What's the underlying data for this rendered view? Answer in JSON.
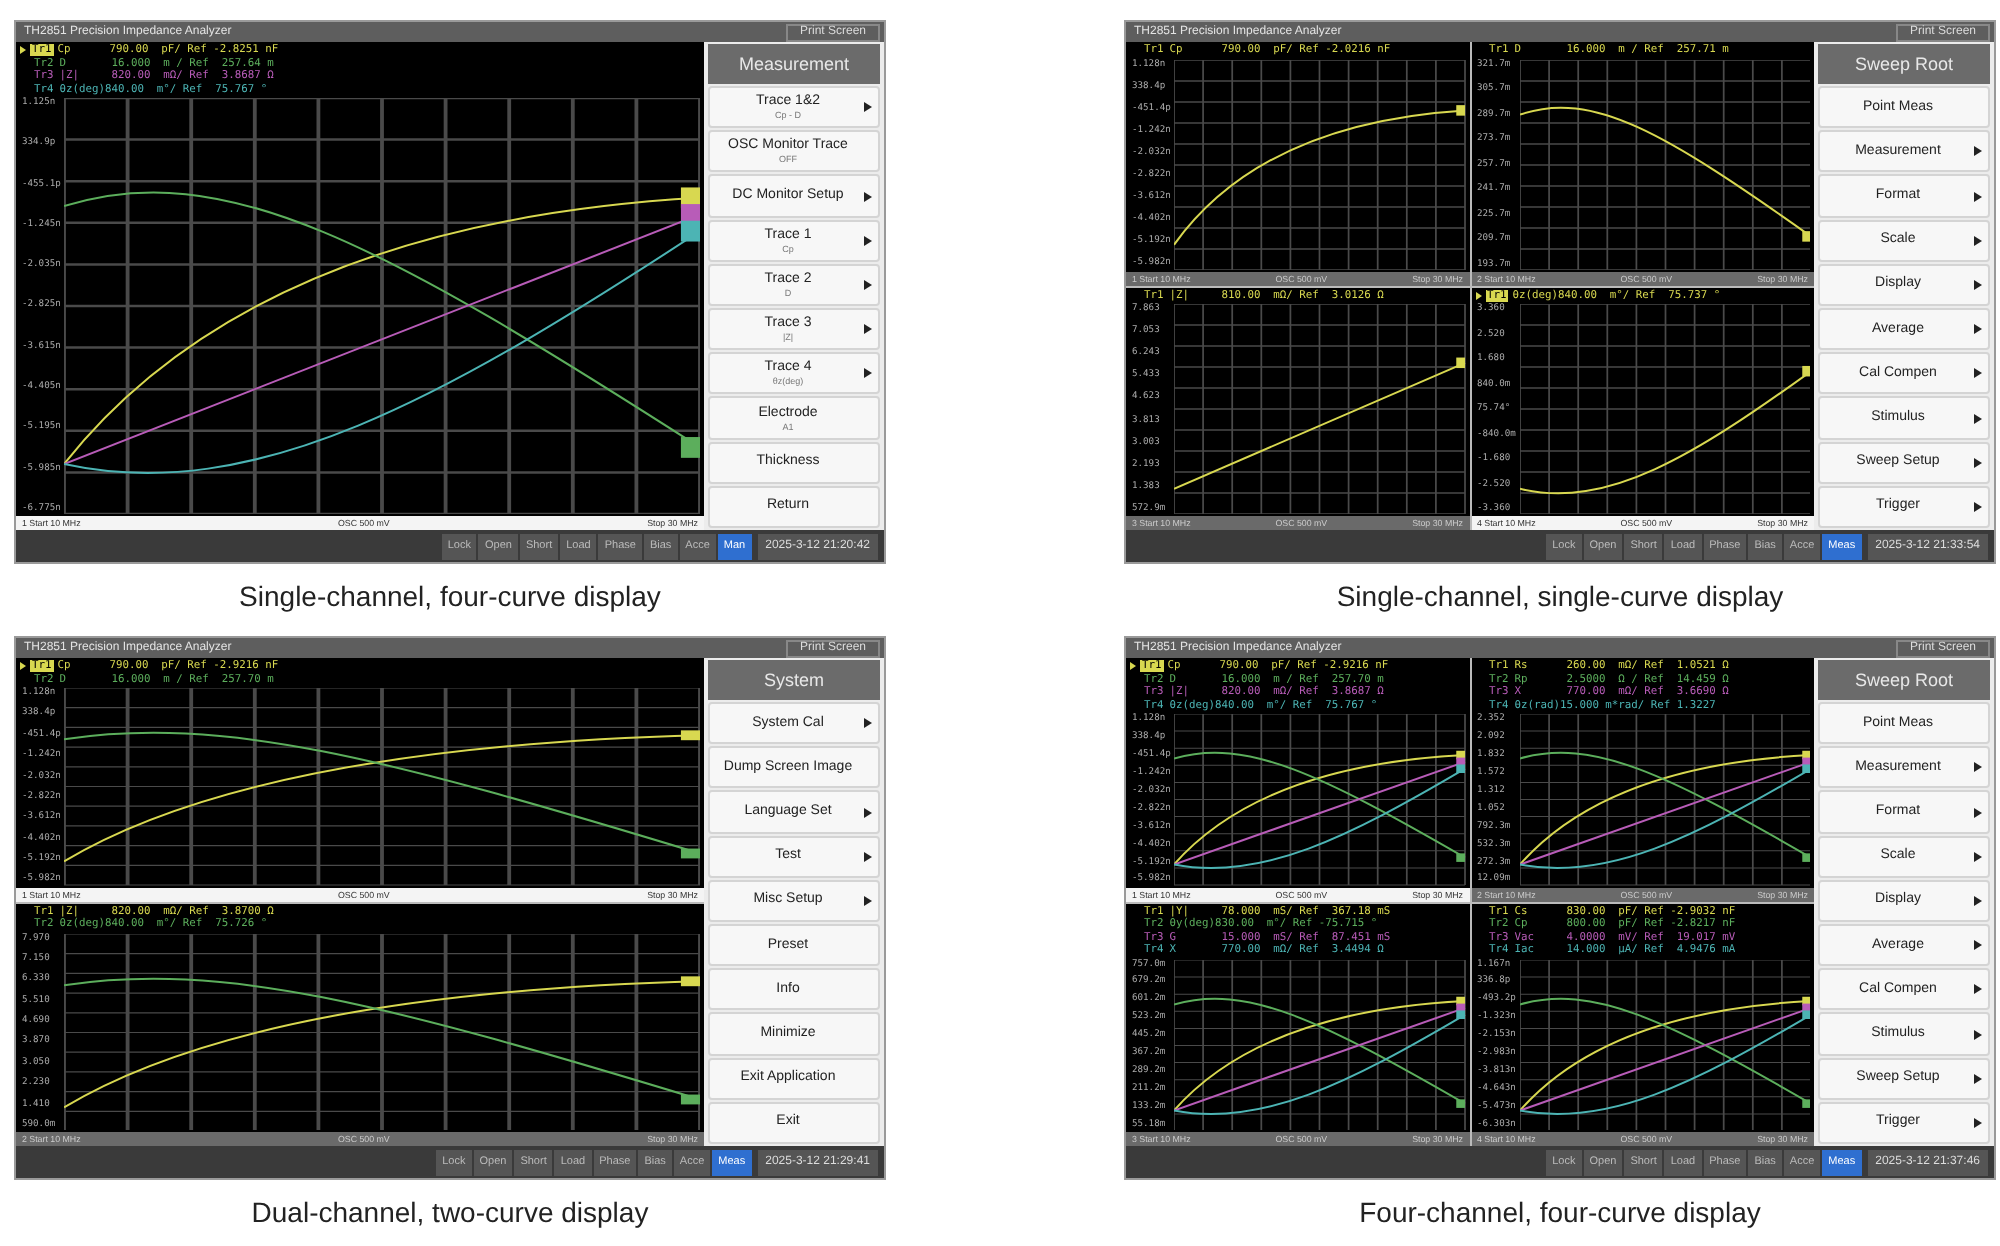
{
  "screens": [
    {
      "caption": "Single-channel, four-curve display",
      "window": {
        "title": "TH2851 Precision Impedance Analyzer",
        "print_button": "Print Screen"
      },
      "panes": [
        {
          "selected": true,
          "traces": [
            {
              "label": "Tr1",
              "text": "Cp      790.00  pF/ Ref -2.8251 nF",
              "color": "#d8d850",
              "selected": true
            },
            {
              "label": "Tr2",
              "text": "D       16.000  m / Ref  257.64 m",
              "color": "#5cae5c",
              "selected": false
            },
            {
              "label": "Tr3",
              "text": "|Z|     820.00  mΩ/ Ref  3.8687 Ω",
              "color": "#b85cb8",
              "selected": false
            },
            {
              "label": "Tr4",
              "text": "θz(deg)840.00  m°/ Ref  75.767 °",
              "color": "#4cb4b4",
              "selected": false
            }
          ],
          "y_ticks": [
            "1.125n",
            "334.9p",
            "-455.1p",
            "-1.245n",
            "-2.035n",
            "-2.825n",
            "-3.615n",
            "-4.405n",
            "-5.195n",
            "-5.985n",
            "-6.775n"
          ],
          "footer": {
            "channel": "1",
            "start": "Start 10 MHz",
            "osc": "OSC 500 mV",
            "stop": "Stop 30 MHz"
          }
        }
      ],
      "menu": {
        "title": "Measurement",
        "items": [
          {
            "label": "Trace 1&2",
            "value": "Cp - D",
            "submenu": true
          },
          {
            "label": "OSC Monitor Trace",
            "value": "OFF",
            "submenu": false
          },
          {
            "label": "DC Monitor Setup",
            "submenu": true
          },
          {
            "label": "Trace 1",
            "value": "Cp",
            "submenu": true
          },
          {
            "label": "Trace 2",
            "value": "D",
            "submenu": true
          },
          {
            "label": "Trace 3",
            "value": "|Z|",
            "submenu": true
          },
          {
            "label": "Trace 4",
            "value": "θz(deg)",
            "submenu": true
          },
          {
            "label": "Electrode",
            "value": "A1",
            "submenu": false
          },
          {
            "label": "Thickness",
            "submenu": false
          },
          {
            "label": "Return",
            "submenu": false
          }
        ]
      },
      "status": {
        "buttons": [
          {
            "label": "Lock",
            "selected": false
          },
          {
            "label": "Open",
            "selected": false
          },
          {
            "label": "Short",
            "selected": false
          },
          {
            "label": "Load",
            "selected": false
          },
          {
            "label": "Phase",
            "selected": false
          },
          {
            "label": "Bias",
            "selected": false
          },
          {
            "label": "Acce",
            "selected": false
          },
          {
            "label": "Man",
            "selected": true
          }
        ],
        "time": "2025-3-12 21:20:42"
      }
    },
    {
      "caption": "Single-channel, single-curve display",
      "window": {
        "title": "TH2851 Precision Impedance Analyzer",
        "print_button": "Print Screen"
      },
      "panes": [
        {
          "selected": false,
          "traces": [
            {
              "label": "Tr1",
              "text": "Cp      790.00  pF/ Ref -2.0216 nF",
              "color": "#d8d850",
              "selected": false
            }
          ],
          "y_ticks": [
            "1.128n",
            "338.4p",
            "-451.4p",
            "-1.242n",
            "-2.032n",
            "-2.822n",
            "-3.612n",
            "-4.402n",
            "-5.192n",
            "-5.982n"
          ],
          "footer": {
            "channel": "1",
            "start": "Start 10 MHz",
            "osc": "OSC 500 mV",
            "stop": "Stop 30 MHz"
          }
        },
        {
          "selected": false,
          "traces": [
            {
              "label": "Tr1",
              "text": "D       16.000  m / Ref  257.71 m",
              "color": "#d8d850",
              "selected": false
            }
          ],
          "y_ticks": [
            "321.7m",
            "305.7m",
            "289.7m",
            "273.7m",
            "257.7m",
            "241.7m",
            "225.7m",
            "209.7m",
            "193.7m"
          ],
          "footer": {
            "channel": "2",
            "start": "Start 10 MHz",
            "osc": "OSC 500 mV",
            "stop": "Stop 30 MHz"
          }
        },
        {
          "selected": false,
          "traces": [
            {
              "label": "Tr1",
              "text": "|Z|     810.00  mΩ/ Ref  3.0126 Ω",
              "color": "#d8d850",
              "selected": false
            }
          ],
          "y_ticks": [
            "7.863",
            "7.053",
            "6.243",
            "5.433",
            "4.623",
            "3.813",
            "3.003",
            "2.193",
            "1.383",
            "572.9m"
          ],
          "footer": {
            "channel": "3",
            "start": "Start 10 MHz",
            "osc": "OSC 500 mV",
            "stop": "Stop 30 MHz"
          }
        },
        {
          "selected": true,
          "traces": [
            {
              "label": "Tr1",
              "text": "θz(deg)840.00  m°/ Ref  75.737 °",
              "color": "#d8d850",
              "selected": true
            }
          ],
          "y_ticks": [
            "3.360",
            "2.520",
            "1.680",
            "840.0m",
            "75.74°",
            "-840.0m",
            "-1.680",
            "-2.520",
            "-3.360"
          ],
          "footer": {
            "channel": "4",
            "start": "Start 10 MHz",
            "osc": "OSC 500 mV",
            "stop": "Stop 30 MHz"
          }
        }
      ],
      "menu": {
        "title": "Sweep Root",
        "items": [
          {
            "label": "Point Meas",
            "submenu": false
          },
          {
            "label": "Measurement",
            "submenu": true
          },
          {
            "label": "Format",
            "submenu": true
          },
          {
            "label": "Scale",
            "submenu": true
          },
          {
            "label": "Display",
            "submenu": true
          },
          {
            "label": "Average",
            "submenu": true
          },
          {
            "label": "Cal Compen",
            "submenu": true
          },
          {
            "label": "Stimulus",
            "submenu": true
          },
          {
            "label": "Sweep Setup",
            "submenu": true
          },
          {
            "label": "Trigger",
            "submenu": true
          }
        ]
      },
      "status": {
        "buttons": [
          {
            "label": "Lock",
            "selected": false
          },
          {
            "label": "Open",
            "selected": false
          },
          {
            "label": "Short",
            "selected": false
          },
          {
            "label": "Load",
            "selected": false
          },
          {
            "label": "Phase",
            "selected": false
          },
          {
            "label": "Bias",
            "selected": false
          },
          {
            "label": "Acce",
            "selected": false
          },
          {
            "label": "Meas",
            "selected": true
          }
        ],
        "time": "2025-3-12 21:33:54"
      }
    },
    {
      "caption": "Dual-channel, two-curve display",
      "window": {
        "title": "TH2851 Precision Impedance Analyzer",
        "print_button": "Print Screen"
      },
      "panes": [
        {
          "selected": true,
          "traces": [
            {
              "label": "Tr1",
              "text": "Cp      790.00  pF/ Ref -2.9216 nF",
              "color": "#d8d850",
              "selected": true
            },
            {
              "label": "Tr2",
              "text": "D       16.000  m / Ref  257.70 m",
              "color": "#5cae5c",
              "selected": false
            }
          ],
          "y_ticks": [
            "1.128n",
            "338.4p",
            "-451.4p",
            "-1.242n",
            "-2.032n",
            "-2.822n",
            "-3.612n",
            "-4.402n",
            "-5.192n",
            "-5.982n"
          ],
          "footer": {
            "channel": "1",
            "start": "Start 10 MHz",
            "osc": "OSC 500 mV",
            "stop": "Stop 30 MHz"
          }
        },
        {
          "selected": false,
          "traces": [
            {
              "label": "Tr1",
              "text": "|Z|     820.00  mΩ/ Ref  3.8700 Ω",
              "color": "#d8d850",
              "selected": false
            },
            {
              "label": "Tr2",
              "text": "θz(deg)840.00  m°/ Ref  75.726 °",
              "color": "#5cae5c",
              "selected": false
            }
          ],
          "y_ticks": [
            "7.970",
            "7.150",
            "6.330",
            "5.510",
            "4.690",
            "3.870",
            "3.050",
            "2.230",
            "1.410",
            "590.0m"
          ],
          "footer": {
            "channel": "2",
            "start": "Start 10 MHz",
            "osc": "OSC 500 mV",
            "stop": "Stop 30 MHz"
          }
        }
      ],
      "menu": {
        "title": "System",
        "items": [
          {
            "label": "System Cal",
            "submenu": true
          },
          {
            "label": "Dump Screen Image",
            "submenu": false
          },
          {
            "label": "Language Set",
            "submenu": true
          },
          {
            "label": "Test",
            "submenu": true
          },
          {
            "label": "Misc Setup",
            "submenu": true
          },
          {
            "label": "Preset",
            "submenu": false
          },
          {
            "label": "Info",
            "submenu": false
          },
          {
            "label": "Minimize",
            "submenu": false
          },
          {
            "label": "Exit Application",
            "submenu": false
          },
          {
            "label": "Exit",
            "submenu": false
          }
        ]
      },
      "status": {
        "buttons": [
          {
            "label": "Lock",
            "selected": false
          },
          {
            "label": "Open",
            "selected": false
          },
          {
            "label": "Short",
            "selected": false
          },
          {
            "label": "Load",
            "selected": false
          },
          {
            "label": "Phase",
            "selected": false
          },
          {
            "label": "Bias",
            "selected": false
          },
          {
            "label": "Acce",
            "selected": false
          },
          {
            "label": "Meas",
            "selected": true
          }
        ],
        "time": "2025-3-12 21:29:41"
      }
    },
    {
      "caption": "Four-channel, four-curve display",
      "window": {
        "title": "TH2851 Precision Impedance Analyzer",
        "print_button": "Print Screen"
      },
      "panes": [
        {
          "selected": true,
          "traces": [
            {
              "label": "Tr1",
              "text": "Cp      790.00  pF/ Ref -2.9216 nF",
              "color": "#d8d850",
              "selected": true
            },
            {
              "label": "Tr2",
              "text": "D       16.000  m / Ref  257.70 m",
              "color": "#5cae5c",
              "selected": false
            },
            {
              "label": "Tr3",
              "text": "|Z|     820.00  mΩ/ Ref  3.8687 Ω",
              "color": "#b85cb8",
              "selected": false
            },
            {
              "label": "Tr4",
              "text": "θz(deg)840.00  m°/ Ref  75.767 °",
              "color": "#4cb4b4",
              "selected": false
            }
          ],
          "y_ticks": [
            "1.128n",
            "338.4p",
            "-451.4p",
            "-1.242n",
            "-2.032n",
            "-2.822n",
            "-3.612n",
            "-4.402n",
            "-5.192n",
            "-5.982n"
          ],
          "footer": {
            "channel": "1",
            "start": "Start 10 MHz",
            "osc": "OSC 500 mV",
            "stop": "Stop 30 MHz"
          }
        },
        {
          "selected": false,
          "traces": [
            {
              "label": "Tr1",
              "text": "Rs      260.00  mΩ/ Ref  1.0521 Ω",
              "color": "#d8d850",
              "selected": false
            },
            {
              "label": "Tr2",
              "text": "Rp      2.5000  Ω / Ref  14.459 Ω",
              "color": "#5cae5c",
              "selected": false
            },
            {
              "label": "Tr3",
              "text": "X       770.00  mΩ/ Ref  3.6690 Ω",
              "color": "#b85cb8",
              "selected": false
            },
            {
              "label": "Tr4",
              "text": "θz(rad)15.000 m*rad/ Ref 1.3227",
              "color": "#4cb4b4",
              "selected": false
            }
          ],
          "y_ticks": [
            "2.352",
            "2.092",
            "1.832",
            "1.572",
            "1.312",
            "1.052",
            "792.3m",
            "532.3m",
            "272.3m",
            "12.09m"
          ],
          "footer": {
            "channel": "2",
            "start": "Start 10 MHz",
            "osc": "OSC 500 mV",
            "stop": "Stop 30 MHz"
          }
        },
        {
          "selected": false,
          "traces": [
            {
              "label": "Tr1",
              "text": "|Y|     78.000  mS/ Ref  367.18 mS",
              "color": "#d8d850",
              "selected": false
            },
            {
              "label": "Tr2",
              "text": "θy(deg)830.00  m°/ Ref -75.715 °",
              "color": "#5cae5c",
              "selected": false
            },
            {
              "label": "Tr3",
              "text": "G       15.000  mS/ Ref  87.451 mS",
              "color": "#b85cb8",
              "selected": false
            },
            {
              "label": "Tr4",
              "text": "X       770.00  mΩ/ Ref  3.4494 Ω",
              "color": "#4cb4b4",
              "selected": false
            }
          ],
          "y_ticks": [
            "757.0m",
            "679.2m",
            "601.2m",
            "523.2m",
            "445.2m",
            "367.2m",
            "289.2m",
            "211.2m",
            "133.2m",
            "55.18m"
          ],
          "footer": {
            "channel": "3",
            "start": "Start 10 MHz",
            "osc": "OSC 500 mV",
            "stop": "Stop 30 MHz"
          }
        },
        {
          "selected": false,
          "traces": [
            {
              "label": "Tr1",
              "text": "Cs      830.00  pF/ Ref -2.9032 nF",
              "color": "#d8d850",
              "selected": false
            },
            {
              "label": "Tr2",
              "text": "Cp      800.00  pF/ Ref -2.8217 nF",
              "color": "#5cae5c",
              "selected": false
            },
            {
              "label": "Tr3",
              "text": "Vac     4.0000  mV/ Ref  19.017 mV",
              "color": "#b85cb8",
              "selected": false
            },
            {
              "label": "Tr4",
              "text": "Iac     14.000  µA/ Ref  4.9476 mA",
              "color": "#4cb4b4",
              "selected": false
            }
          ],
          "y_ticks": [
            "1.167n",
            "336.8p",
            "-493.2p",
            "-1.323n",
            "-2.153n",
            "-2.983n",
            "-3.813n",
            "-4.643n",
            "-5.473n",
            "-6.303n"
          ],
          "footer": {
            "channel": "4",
            "start": "Start 10 MHz",
            "osc": "OSC 500 mV",
            "stop": "Stop 30 MHz"
          }
        }
      ],
      "menu": {
        "title": "Sweep Root",
        "items": [
          {
            "label": "Point Meas",
            "submenu": false
          },
          {
            "label": "Measurement",
            "submenu": true
          },
          {
            "label": "Format",
            "submenu": true
          },
          {
            "label": "Scale",
            "submenu": true
          },
          {
            "label": "Display",
            "submenu": true
          },
          {
            "label": "Average",
            "submenu": true
          },
          {
            "label": "Cal Compen",
            "submenu": true
          },
          {
            "label": "Stimulus",
            "submenu": true
          },
          {
            "label": "Sweep Setup",
            "submenu": true
          },
          {
            "label": "Trigger",
            "submenu": true
          }
        ]
      },
      "status": {
        "buttons": [
          {
            "label": "Lock",
            "selected": false
          },
          {
            "label": "Open",
            "selected": false
          },
          {
            "label": "Short",
            "selected": false
          },
          {
            "label": "Load",
            "selected": false
          },
          {
            "label": "Phase",
            "selected": false
          },
          {
            "label": "Bias",
            "selected": false
          },
          {
            "label": "Acce",
            "selected": false
          },
          {
            "label": "Meas",
            "selected": true
          }
        ],
        "time": "2025-3-12 21:37:46"
      }
    }
  ]
}
